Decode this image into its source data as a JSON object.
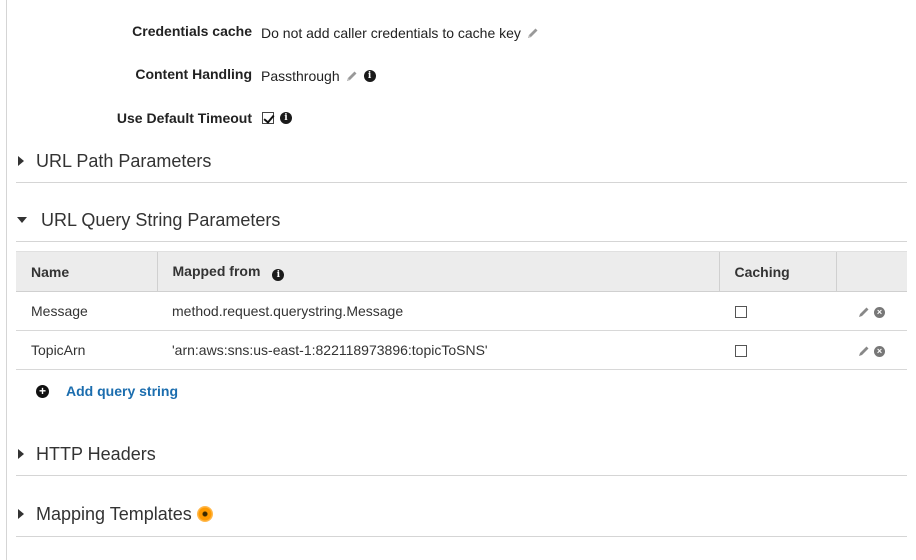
{
  "settings": {
    "credentials_cache": {
      "label": "Credentials cache",
      "value": "Do not add caller credentials to cache key"
    },
    "content_handling": {
      "label": "Content Handling",
      "value": "Passthrough"
    },
    "default_timeout": {
      "label": "Use Default Timeout",
      "checked": true
    }
  },
  "sections": {
    "url_path": {
      "title": "URL Path Parameters",
      "expanded": false
    },
    "url_query": {
      "title": "URL Query String Parameters",
      "expanded": true
    },
    "http_headers": {
      "title": "HTTP Headers",
      "expanded": false
    },
    "mapping_templates": {
      "title": "Mapping Templates",
      "expanded": false
    }
  },
  "query_table": {
    "headers": {
      "name": "Name",
      "mapped_from": "Mapped from",
      "caching": "Caching"
    },
    "rows": [
      {
        "name": "Message",
        "mapped_from": "method.request.querystring.Message",
        "caching": false
      },
      {
        "name": "TopicArn",
        "mapped_from": "'arn:aws:sns:us-east-1:822118973896:topicToSNS'",
        "caching": false
      }
    ]
  },
  "add_query_label": "Add query string",
  "icons": {
    "edit": "pencil-icon",
    "info": "info-icon",
    "delete": "delete-icon",
    "add": "plus-circle-icon",
    "warning": "orange-badge-icon"
  },
  "colors": {
    "link": "#1b6dae",
    "table_header_bg": "#ececec",
    "badge": "#ff9a00"
  }
}
